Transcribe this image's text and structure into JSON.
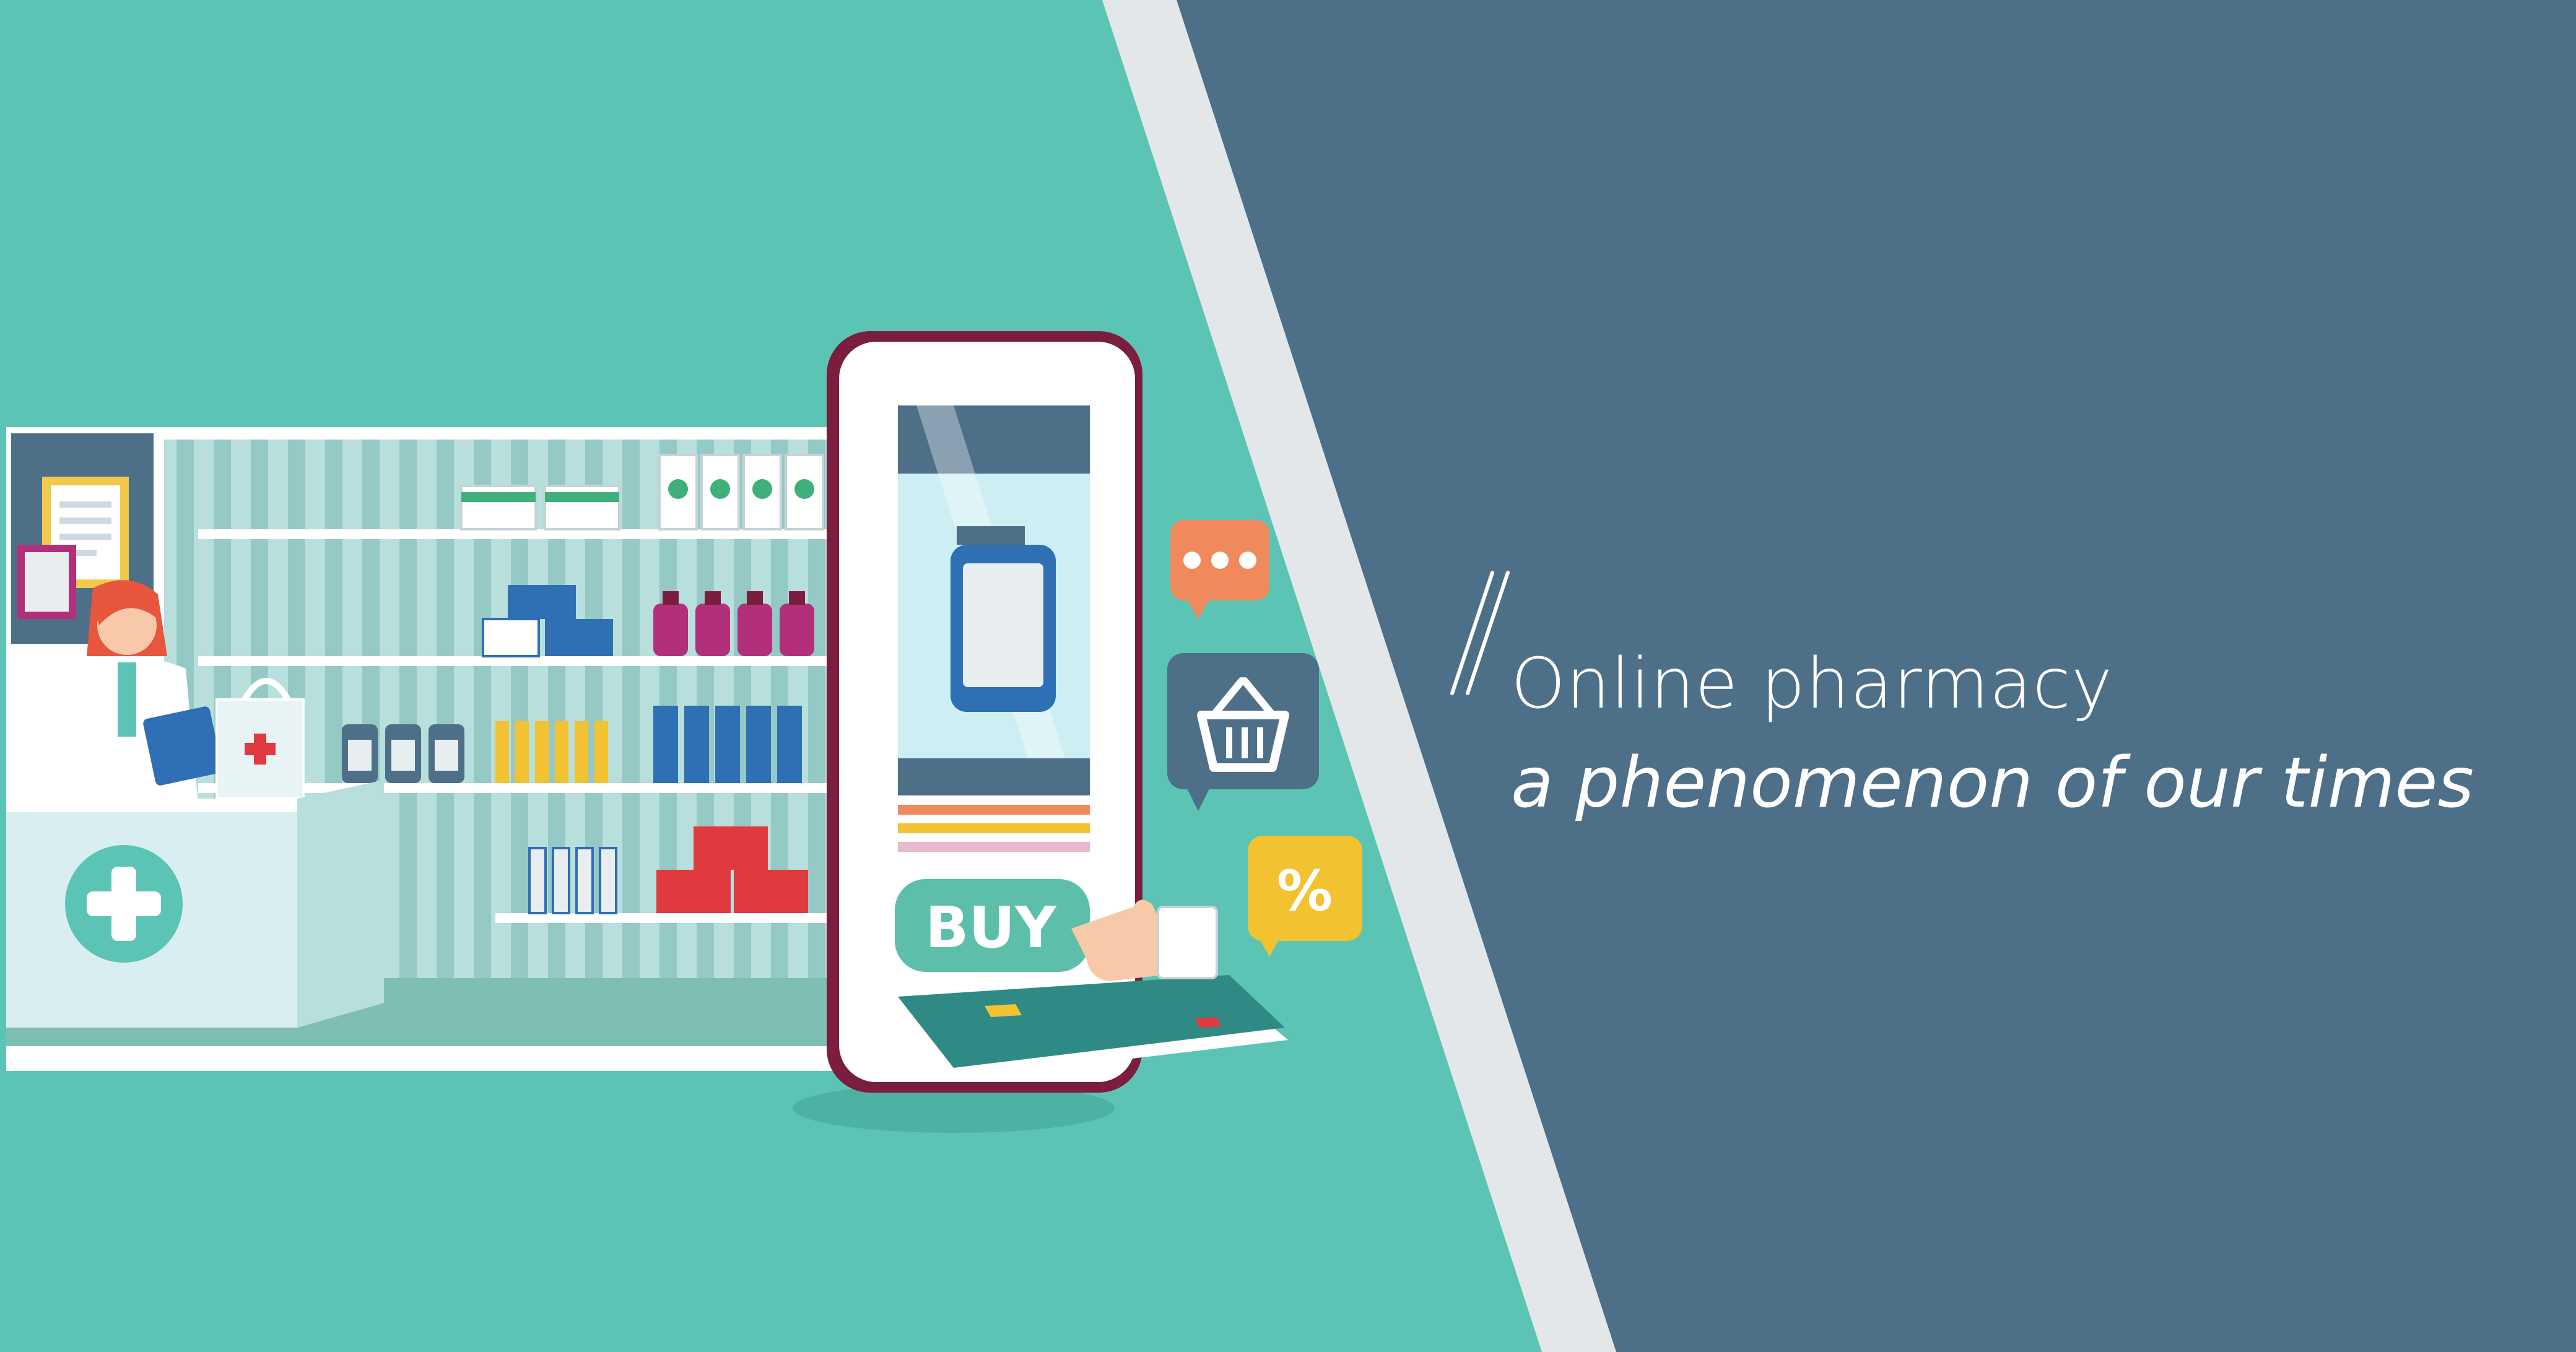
{
  "headline": {
    "title": "Online pharmacy",
    "subtitle": "a phenomenon of our times"
  },
  "phone": {
    "buy_label": "BUY"
  },
  "badges": {
    "discount": "%"
  },
  "colors": {
    "teal_background": "#5bc4b5",
    "slate_panel": "#4d6f88",
    "divider_stripe": "#e3e7ea",
    "phone_frame": "#7a1d3e",
    "buy_button": "#5dbfaa",
    "card": "#2f8a86",
    "shelf_product_red": "#e03a3e",
    "shelf_product_purple": "#b2307a",
    "shelf_product_blue": "#2f6fb3",
    "shelf_product_yellow": "#f2c230"
  }
}
